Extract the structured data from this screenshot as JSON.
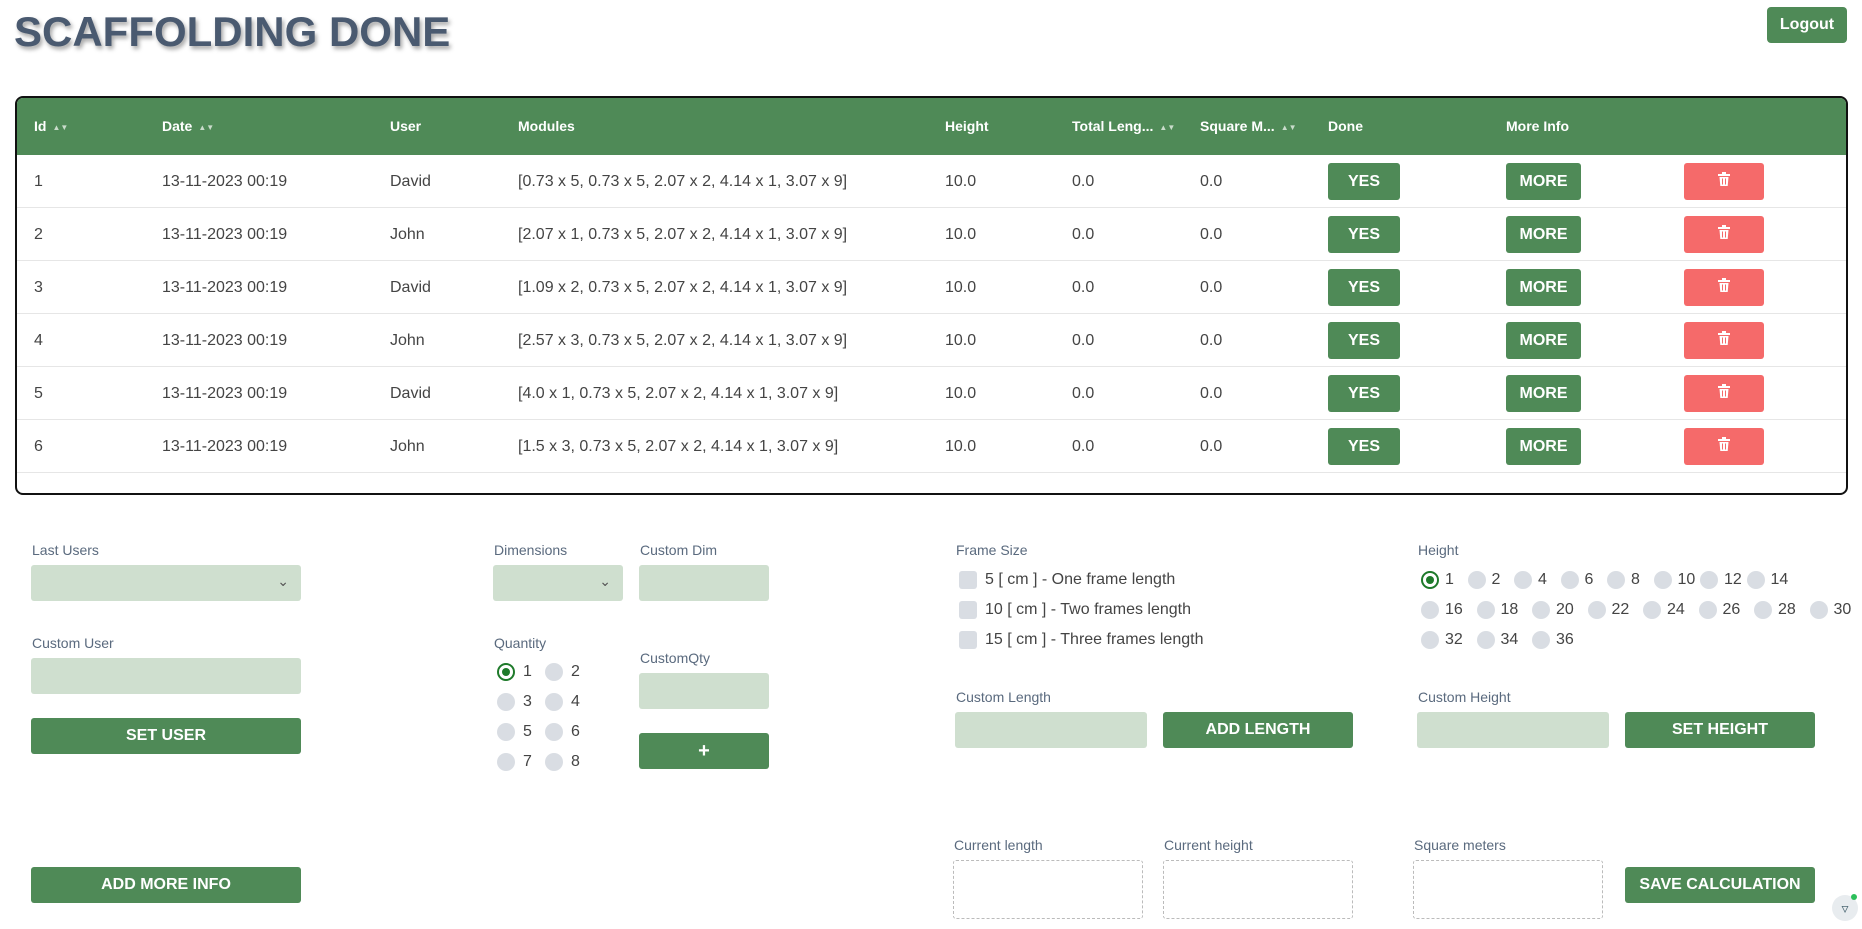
{
  "header": {
    "title": "SCAFFOLDING DONE",
    "logout_label": "Logout"
  },
  "table": {
    "columns": [
      "Id",
      "Date",
      "User",
      "Modules",
      "Height",
      "Total Leng...",
      "Square M...",
      "Done",
      "More Info"
    ],
    "rows": [
      {
        "id": "1",
        "date": "13-11-2023 00:19",
        "user": "David",
        "modules": "[0.73 x 5, 0.73 x 5, 2.07 x 2, 4.14 x 1, 3.07 x 9]",
        "height": "10.0",
        "total_length": "0.0",
        "square_meters": "0.0",
        "done": "YES",
        "more": "MORE"
      },
      {
        "id": "2",
        "date": "13-11-2023 00:19",
        "user": "John",
        "modules": "[2.07 x 1, 0.73 x 5, 2.07 x 2, 4.14 x 1, 3.07 x 9]",
        "height": "10.0",
        "total_length": "0.0",
        "square_meters": "0.0",
        "done": "YES",
        "more": "MORE"
      },
      {
        "id": "3",
        "date": "13-11-2023 00:19",
        "user": "David",
        "modules": "[1.09 x 2, 0.73 x 5, 2.07 x 2, 4.14 x 1, 3.07 x 9]",
        "height": "10.0",
        "total_length": "0.0",
        "square_meters": "0.0",
        "done": "YES",
        "more": "MORE"
      },
      {
        "id": "4",
        "date": "13-11-2023 00:19",
        "user": "John",
        "modules": "[2.57 x 3, 0.73 x 5, 2.07 x 2, 4.14 x 1, 3.07 x 9]",
        "height": "10.0",
        "total_length": "0.0",
        "square_meters": "0.0",
        "done": "YES",
        "more": "MORE"
      },
      {
        "id": "5",
        "date": "13-11-2023 00:19",
        "user": "David",
        "modules": "[4.0 x 1, 0.73 x 5, 2.07 x 2, 4.14 x 1, 3.07 x 9]",
        "height": "10.0",
        "total_length": "0.0",
        "square_meters": "0.0",
        "done": "YES",
        "more": "MORE"
      },
      {
        "id": "6",
        "date": "13-11-2023 00:19",
        "user": "John",
        "modules": "[1.5 x 3, 0.73 x 5, 2.07 x 2, 4.14 x 1, 3.07 x 9]",
        "height": "10.0",
        "total_length": "0.0",
        "square_meters": "0.0",
        "done": "YES",
        "more": "MORE"
      }
    ]
  },
  "users": {
    "last_users_label": "Last Users",
    "last_users_value": "",
    "custom_user_label": "Custom User",
    "custom_user_value": "",
    "set_user_label": "SET USER",
    "add_more_info_label": "ADD MORE INFO"
  },
  "dimensions": {
    "dimensions_label": "Dimensions",
    "dimensions_value": "",
    "custom_dim_label": "Custom Dim",
    "custom_dim_value": "",
    "quantity_label": "Quantity",
    "quantity_options": [
      "1",
      "2",
      "3",
      "4",
      "5",
      "6",
      "7",
      "8"
    ],
    "quantity_selected": "1",
    "custom_qty_label": "CustomQty",
    "custom_qty_value": "",
    "add_label": "+"
  },
  "frame": {
    "frame_size_label": "Frame Size",
    "options": [
      "5 [ cm ] - One frame length",
      "10 [ cm ] - Two frames length",
      "15 [ cm ] - Three frames length"
    ],
    "custom_length_label": "Custom Length",
    "custom_length_value": "",
    "add_length_label": "ADD LENGTH"
  },
  "height": {
    "height_label": "Height",
    "options": [
      "1",
      "2",
      "4",
      "6",
      "8",
      "10",
      "12",
      "14",
      "16",
      "18",
      "20",
      "22",
      "24",
      "26",
      "28",
      "30",
      "32",
      "34",
      "36"
    ],
    "selected": "1",
    "custom_height_label": "Custom Height",
    "custom_height_value": "",
    "set_height_label": "SET HEIGHT"
  },
  "summary": {
    "current_length_label": "Current length",
    "current_height_label": "Current height",
    "square_meters_label": "Square meters",
    "current_length_value": "",
    "current_height_value": "",
    "square_meters_value": "",
    "save_label": "SAVE CALCULATION"
  },
  "icons": {
    "sort": "sort-icon",
    "trash": "trash-icon",
    "chevron": "chevron-down-icon",
    "corner": "filter-icon"
  },
  "colors": {
    "primary_green": "#4f8a57",
    "field_green": "#cfdfcf",
    "delete_red": "#f56a6a",
    "title_color": "#4a5a70"
  }
}
